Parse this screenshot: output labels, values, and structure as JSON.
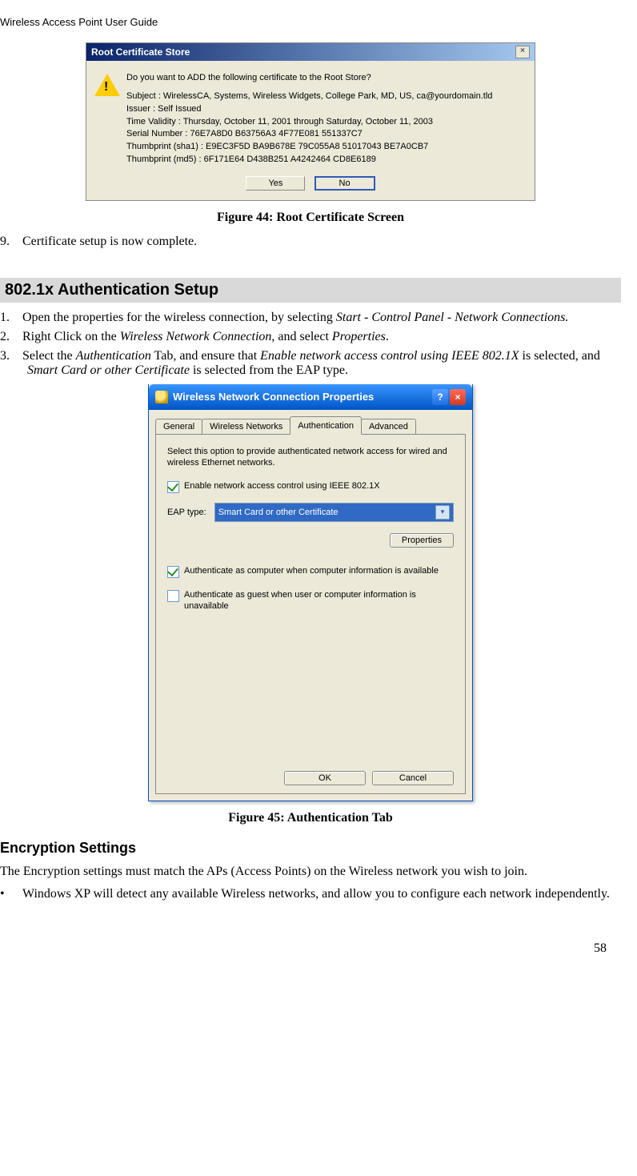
{
  "header": "Wireless Access Point User Guide",
  "dialog1": {
    "title": "Root Certificate Store",
    "close_glyph": "×",
    "question": "Do you want to ADD the following certificate to the Root Store?",
    "lines": [
      "Subject : WirelessCA, Systems, Wireless Widgets, College Park, MD, US, ca@yourdomain.tld",
      "Issuer : Self Issued",
      "Time Validity : Thursday, October 11, 2001 through Saturday, October 11, 2003",
      "Serial Number : 76E7A8D0 B63756A3 4F77E081 551337C7",
      "Thumbprint (sha1) : E9EC3F5D BA9B678E 79C055A8 51017043 BE7A0CB7",
      "Thumbprint (md5) : 6F171E64 D438B251 A4242464 CD8E6189"
    ],
    "yes": "Yes",
    "no": "No"
  },
  "figure44_caption": "Figure 44: Root Certificate Screen",
  "step9": {
    "num": "9.",
    "text": "Certificate setup is now complete."
  },
  "section_heading": "802.1x Authentication Setup",
  "step1": {
    "num": "1.",
    "pre": "Open the properties for the wireless connection, by selecting ",
    "italic": "Start - Control Panel - Network Connections.",
    "post": ""
  },
  "step2": {
    "num": "2.",
    "pre": "Right Click on the ",
    "italic1": "Wireless Network Connection",
    "mid": ", and select ",
    "italic2": "Properties",
    "post": "."
  },
  "step3": {
    "num": "3.",
    "pre": "Select the ",
    "italic1": "Authentication",
    "mid1": " Tab, and ensure that ",
    "italic2": "Enable network access control using IEEE 802.1X",
    "mid2": " is selected, and ",
    "italic3": "Smart Card or other Certificate",
    "post": " is selected from the EAP type."
  },
  "dialog2": {
    "title": "Wireless Network Connection Properties",
    "help_glyph": "?",
    "close_glyph": "×",
    "tabs": {
      "general": "General",
      "wireless": "Wireless Networks",
      "auth": "Authentication",
      "advanced": "Advanced"
    },
    "desc": "Select this option to provide authenticated network access for wired and wireless Ethernet networks.",
    "chk1": "Enable network  access control using IEEE 802.1X",
    "eap_label": "EAP type:",
    "eap_value": "Smart Card or other Certificate",
    "properties_btn": "Properties",
    "chk2": "Authenticate as computer when computer information is available",
    "chk3": "Authenticate as guest when user or computer information is unavailable",
    "ok": "OK",
    "cancel": "Cancel"
  },
  "figure45_caption": "Figure 45: Authentication Tab",
  "enc_heading": "Encryption Settings",
  "enc_para": "The Encryption settings must match the APs (Access Points) on the Wireless network you wish to join.",
  "enc_bullet": {
    "dot": "•",
    "text": "Windows XP will detect any available Wireless networks, and allow you to configure each network independently."
  },
  "page_number": "58"
}
